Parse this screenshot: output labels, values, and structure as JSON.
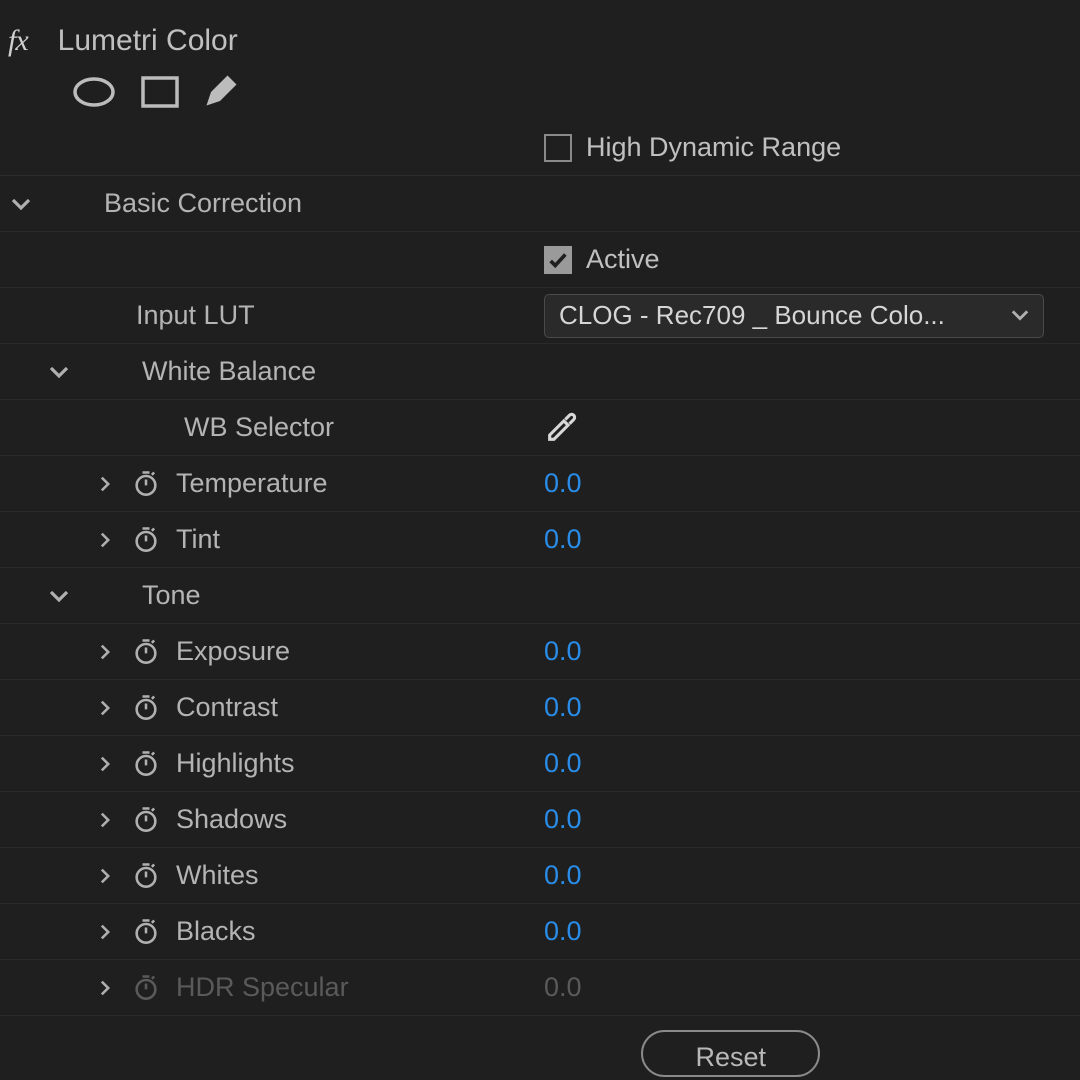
{
  "effect": {
    "title": "Lumetri Color"
  },
  "hdr_checkbox": {
    "label": "High Dynamic Range",
    "checked": false
  },
  "sections": {
    "basic_correction": "Basic Correction",
    "white_balance": "White Balance",
    "tone": "Tone"
  },
  "active": {
    "label": "Active",
    "checked": true
  },
  "input_lut": {
    "label": "Input LUT",
    "value": "CLOG - Rec709 _ Bounce Colo..."
  },
  "wb_selector_label": "WB Selector",
  "params": {
    "temperature": {
      "label": "Temperature",
      "value": "0.0"
    },
    "tint": {
      "label": "Tint",
      "value": "0.0"
    },
    "exposure": {
      "label": "Exposure",
      "value": "0.0"
    },
    "contrast": {
      "label": "Contrast",
      "value": "0.0"
    },
    "highlights": {
      "label": "Highlights",
      "value": "0.0"
    },
    "shadows": {
      "label": "Shadows",
      "value": "0.0"
    },
    "whites": {
      "label": "Whites",
      "value": "0.0"
    },
    "blacks": {
      "label": "Blacks",
      "value": "0.0"
    },
    "hdr_specular": {
      "label": "HDR Specular",
      "value": "0.0"
    }
  },
  "reset_label": "Reset"
}
